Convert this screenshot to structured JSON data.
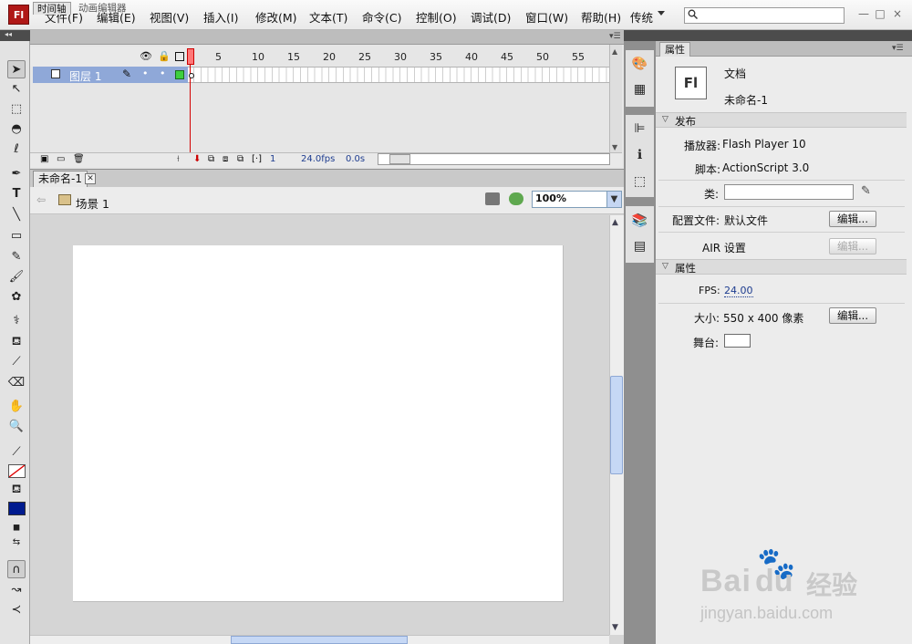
{
  "menubar": {
    "logo": "Fl",
    "items": [
      "文件(F)",
      "编辑(E)",
      "视图(V)",
      "插入(I)",
      "修改(M)",
      "文本(T)",
      "命令(C)",
      "控制(O)",
      "调试(D)",
      "窗口(W)",
      "帮助(H)"
    ],
    "workspace": "传统",
    "search_placeholder": "",
    "window_controls": [
      "—",
      "□",
      "×"
    ]
  },
  "timeline": {
    "tabs": [
      "时间轴",
      "动画编辑器"
    ],
    "layer_name": "图层 1",
    "frame_numbers": [
      "5",
      "10",
      "15",
      "20",
      "25",
      "30",
      "35",
      "40",
      "45",
      "50",
      "55"
    ],
    "current_frame": "1",
    "fps": "24.0fps",
    "time": "0.0s"
  },
  "document": {
    "tab_title": "未命名-1",
    "scene": "场景 1",
    "zoom": "100%"
  },
  "properties": {
    "tab": "属性",
    "doc_icon": "Fl",
    "doc_type": "文档",
    "doc_name": "未命名-1",
    "publish_section": "发布",
    "player_label": "播放器:",
    "player_value": "Flash Player 10",
    "script_label": "脚本:",
    "script_value": "ActionScript 3.0",
    "class_label": "类:",
    "profile_label": "配置文件:",
    "profile_value": "默认文件",
    "edit_label": "编辑...",
    "air_label": "AIR 设置",
    "props_section": "属性",
    "fps_label": "FPS:",
    "fps_value": "24.00",
    "size_label": "大小:",
    "size_value": "550 x 400 像素",
    "stage_label": "舞台:",
    "stage_color": "#ffffff"
  },
  "watermark": {
    "brand": "Bai",
    "brand2": "du",
    "jingyan": "经验",
    "url": "jingyan.baidu.com"
  }
}
